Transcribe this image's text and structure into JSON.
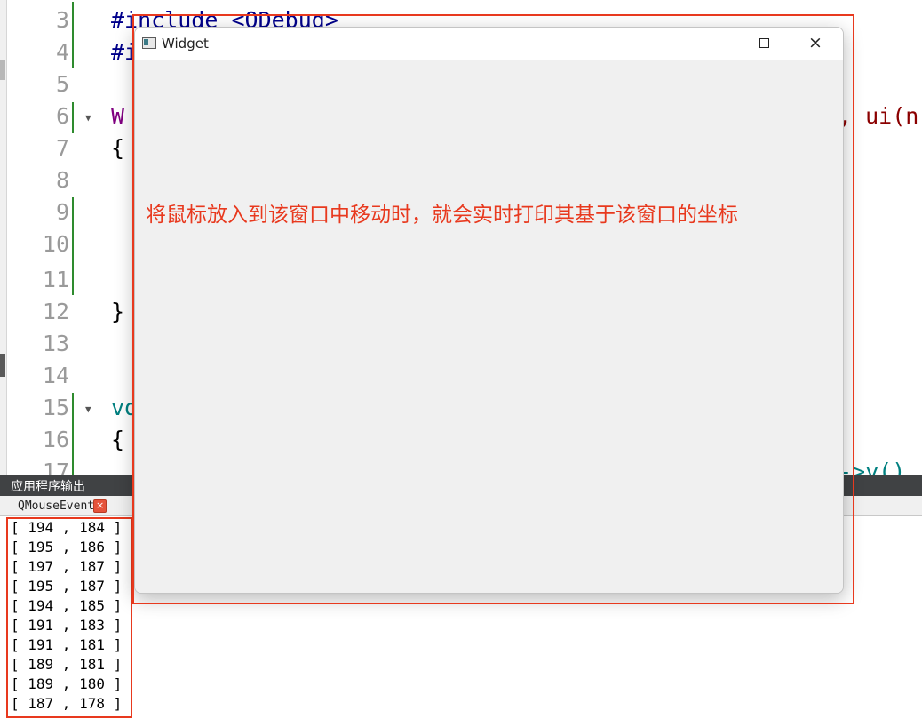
{
  "editor": {
    "line_numbers": [
      "3",
      "4",
      "5",
      "6",
      "7",
      "8",
      "9",
      "10",
      "11",
      "12",
      "13",
      "14",
      "15",
      "16",
      "17"
    ],
    "code_lines": [
      {
        "text": "#include <QDebug>"
      },
      {
        "text": "#i"
      },
      {
        "text": "W"
      },
      {
        "text": "{"
      },
      {
        "text": "}"
      },
      {
        "text": "vo"
      },
      {
        "text": "{"
      }
    ],
    "right_fragment_line6": ", ui(n",
    "right_fragment_line17": "->y()"
  },
  "output": {
    "header": "应用程序输出",
    "tab_label": "QMouseEvent",
    "tab_close": "×",
    "lines": [
      "[ 194 , 184 ]",
      "[ 195 , 186 ]",
      "[ 197 , 187 ]",
      "[ 195 , 187 ]",
      "[ 194 , 185 ]",
      "[ 191 , 183 ]",
      "[ 191 , 181 ]",
      "[ 189 , 181 ]",
      "[ 189 , 180 ]",
      "[ 187 , 178 ]"
    ]
  },
  "widget": {
    "title": "Widget",
    "annotation": "将鼠标放入到该窗口中移动时，就会实时打印其基于该窗口的坐标",
    "minimize_icon": "minimize-icon",
    "maximize_icon": "maximize-icon",
    "close_icon": "×"
  },
  "colors": {
    "highlight_red": "#e8391e",
    "output_header_bg": "#404244",
    "change_bar_green": "#2e8b2e"
  }
}
